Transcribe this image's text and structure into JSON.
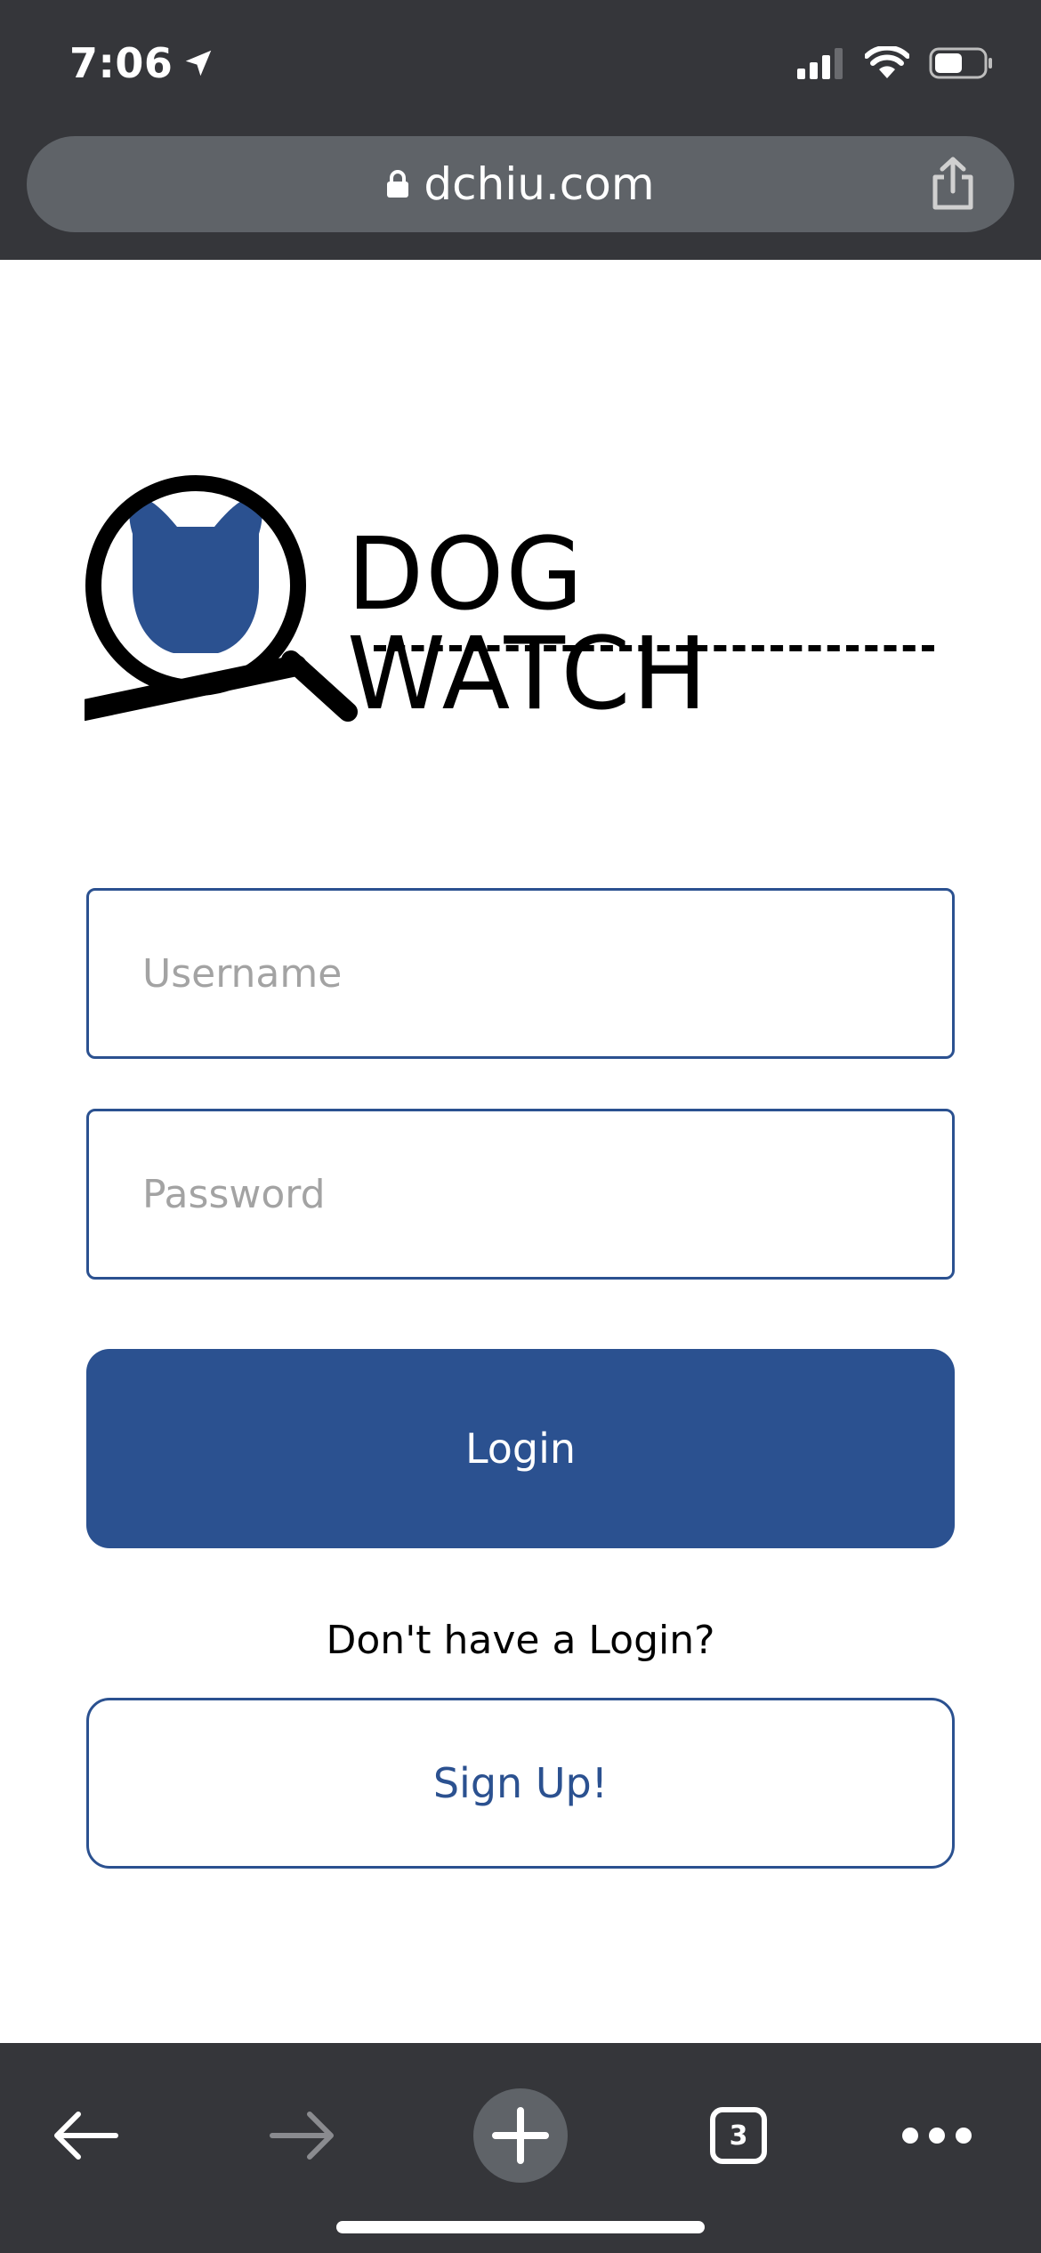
{
  "status_bar": {
    "time": "7:06"
  },
  "address_bar": {
    "domain": "dchiu.com"
  },
  "logo": {
    "title": "DOG WATCH"
  },
  "login_form": {
    "username_placeholder": "Username",
    "username_value": "",
    "password_placeholder": "Password",
    "password_value": "",
    "login_label": "Login",
    "no_login_text": "Don't have a Login?",
    "signup_label": "Sign Up!"
  },
  "toolbar": {
    "tab_count": "3"
  },
  "colors": {
    "brand_blue": "#2b5190",
    "chrome_dark": "#35363a",
    "chrome_pill": "#5f6368",
    "placeholder_gray": "#a3a3a3"
  },
  "icons": {
    "status_bar": [
      "location-arrow-icon",
      "cellular-signal-icon",
      "wifi-icon",
      "battery-icon"
    ],
    "address_bar": [
      "lock-icon",
      "share-icon"
    ],
    "toolbar": [
      "back-arrow-icon",
      "forward-arrow-icon",
      "plus-icon",
      "tabs-icon",
      "more-icon"
    ]
  }
}
